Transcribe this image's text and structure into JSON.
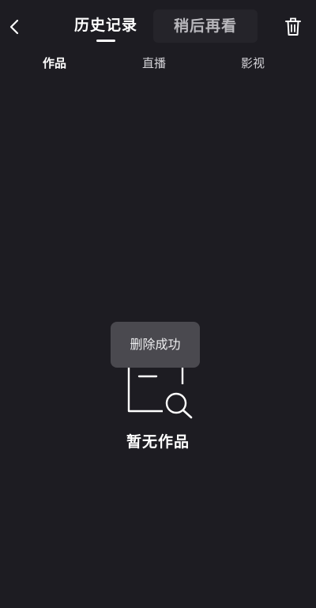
{
  "header": {
    "tabs": [
      {
        "label": "历史记录",
        "active": true
      },
      {
        "label": "稍后再看",
        "active": false
      }
    ],
    "back_icon": "chevron-left-icon",
    "delete_icon": "trash-icon"
  },
  "subtabs": [
    {
      "label": "作品",
      "active": true
    },
    {
      "label": "直播",
      "active": false
    },
    {
      "label": "影视",
      "active": false
    }
  ],
  "empty_state": {
    "icon": "empty-search-icon",
    "text": "暂无作品"
  },
  "toast": {
    "text": "删除成功"
  },
  "colors": {
    "background": "#1d1c22",
    "toast_bg": "#4a494f",
    "tab_inactive_bg": "#25242a"
  }
}
